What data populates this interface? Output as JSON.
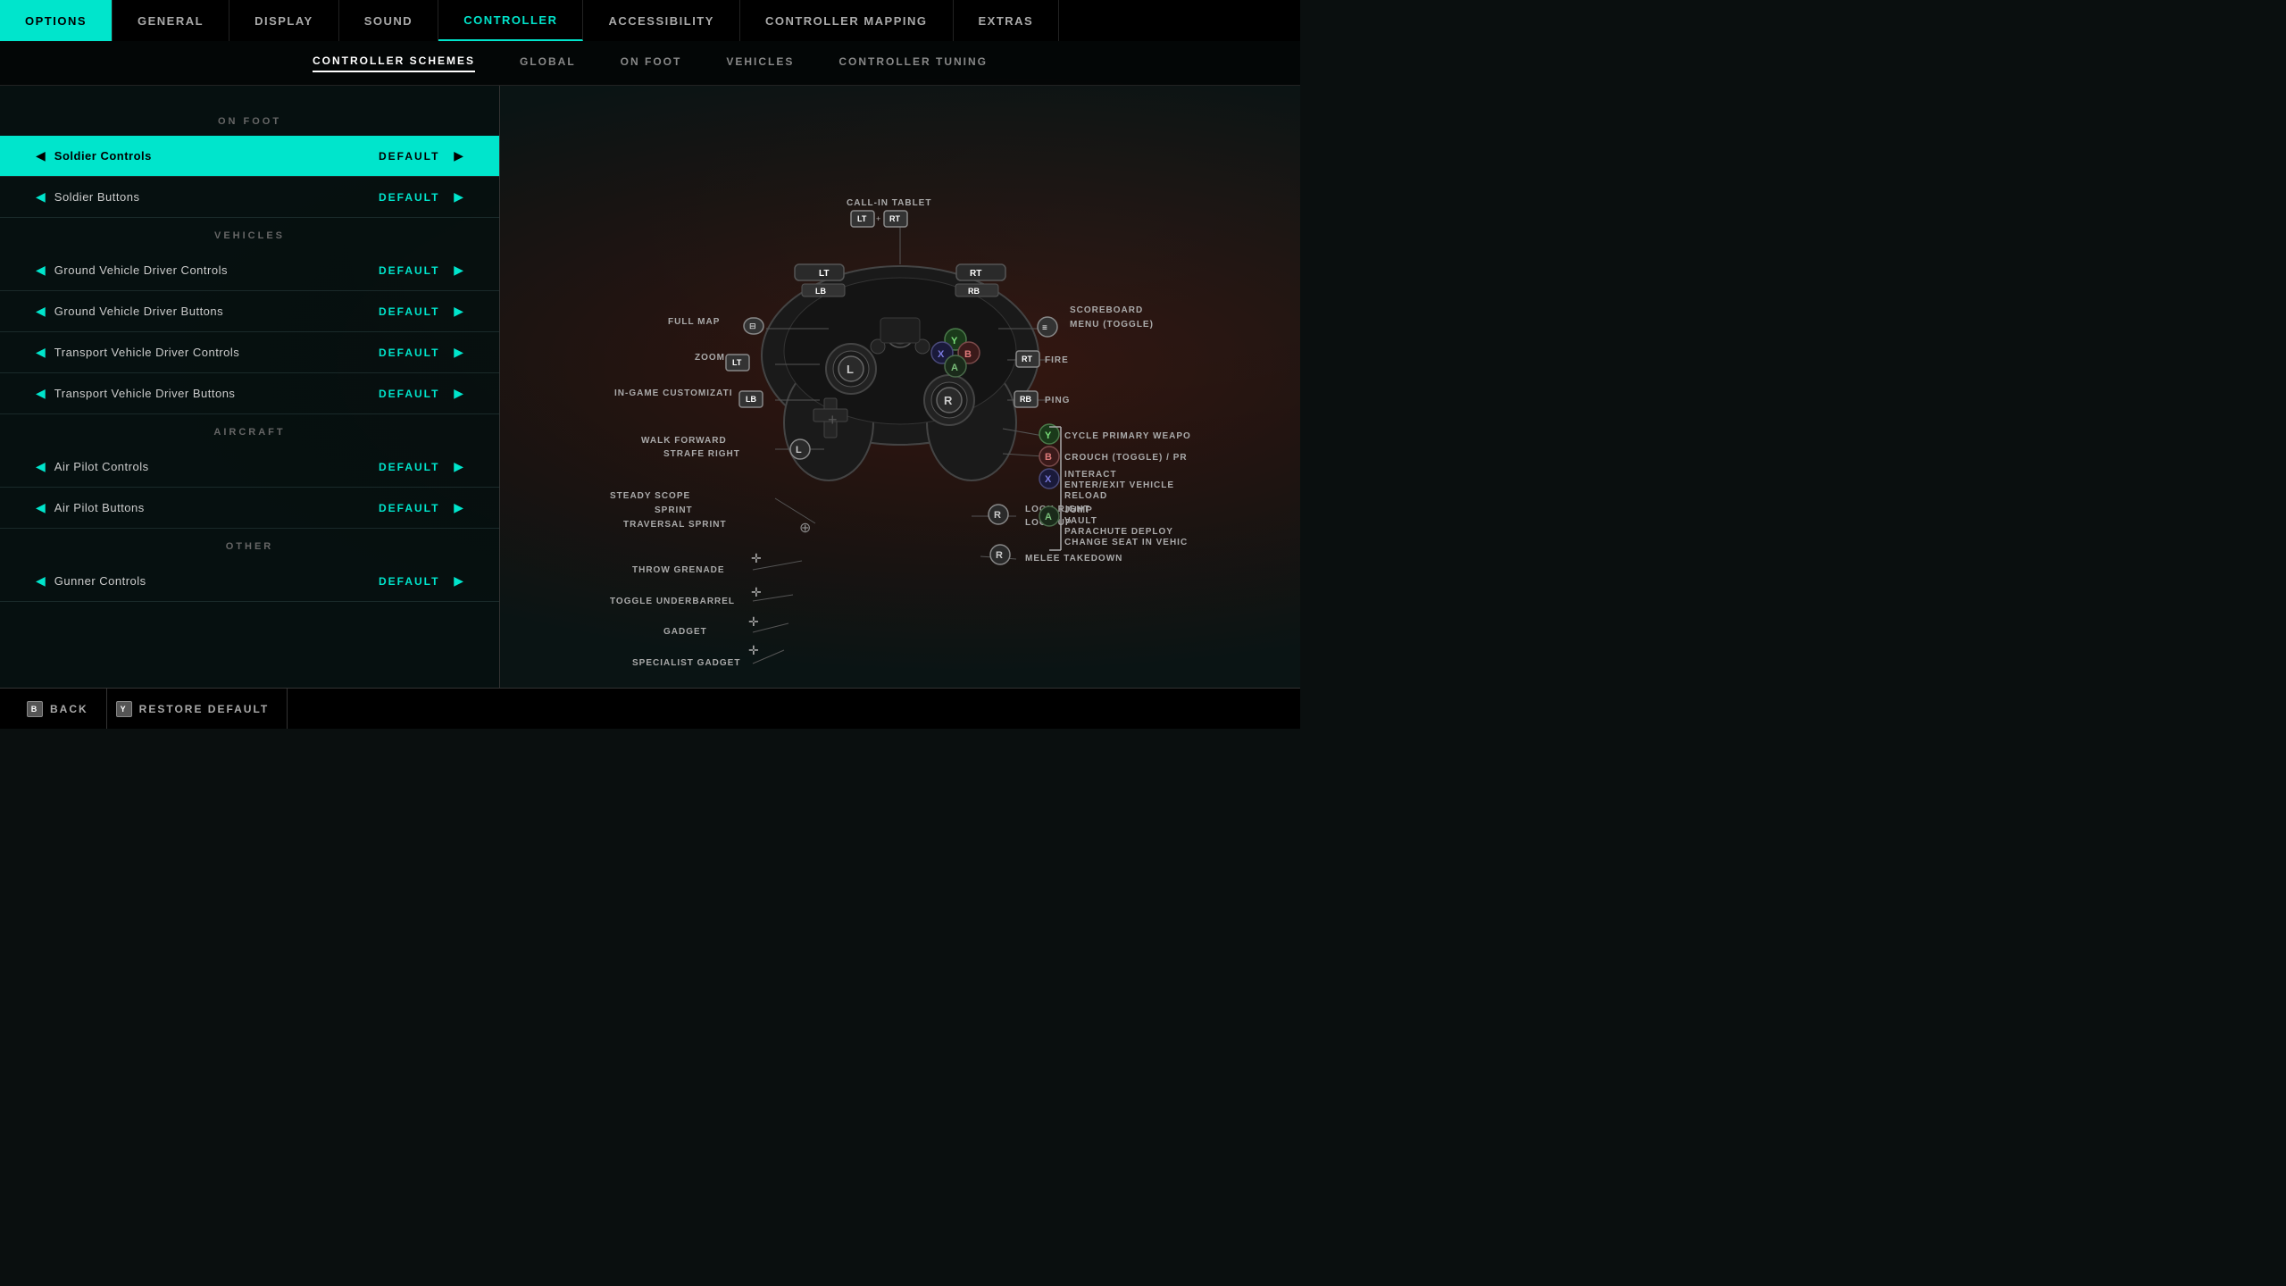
{
  "topNav": {
    "items": [
      {
        "id": "options",
        "label": "OPTIONS",
        "active": true
      },
      {
        "id": "general",
        "label": "GENERAL",
        "active": false
      },
      {
        "id": "display",
        "label": "DISPLAY",
        "active": false
      },
      {
        "id": "sound",
        "label": "SOUND",
        "active": false
      },
      {
        "id": "controller",
        "label": "CONTROLLER",
        "active": true,
        "highlighted": true
      },
      {
        "id": "accessibility",
        "label": "ACCESSIBILITY",
        "active": false
      },
      {
        "id": "controller-mapping",
        "label": "CONTROLLER MAPPING",
        "active": false
      },
      {
        "id": "extras",
        "label": "EXTRAS",
        "active": false
      }
    ]
  },
  "subNav": {
    "items": [
      {
        "id": "controller-schemes",
        "label": "CONTROLLER SCHEMES",
        "active": true
      },
      {
        "id": "global",
        "label": "GLOBAL",
        "active": false
      },
      {
        "id": "on-foot",
        "label": "ON FOOT",
        "active": false
      },
      {
        "id": "vehicles",
        "label": "VEHICLES",
        "active": false
      },
      {
        "id": "controller-tuning",
        "label": "CONTROLLER TUNING",
        "active": false
      }
    ]
  },
  "leftPanel": {
    "sections": [
      {
        "header": "ON FOOT",
        "items": [
          {
            "name": "Soldier Controls",
            "value": "DEFAULT",
            "highlighted": true
          },
          {
            "name": "Soldier Buttons",
            "value": "DEFAULT",
            "highlighted": false
          }
        ]
      },
      {
        "header": "VEHICLES",
        "items": [
          {
            "name": "Ground Vehicle Driver Controls",
            "value": "DEFAULT",
            "highlighted": false
          },
          {
            "name": "Ground Vehicle Driver Buttons",
            "value": "DEFAULT",
            "highlighted": false
          },
          {
            "name": "Transport Vehicle Driver Controls",
            "value": "DEFAULT",
            "highlighted": false
          },
          {
            "name": "Transport Vehicle Driver Buttons",
            "value": "DEFAULT",
            "highlighted": false
          }
        ]
      },
      {
        "header": "AIRCRAFT",
        "items": [
          {
            "name": "Air Pilot Controls",
            "value": "DEFAULT",
            "highlighted": false
          },
          {
            "name": "Air Pilot Buttons",
            "value": "DEFAULT",
            "highlighted": false
          }
        ]
      },
      {
        "header": "OTHER",
        "items": [
          {
            "name": "Gunner Controls",
            "value": "DEFAULT",
            "highlighted": false
          }
        ]
      }
    ]
  },
  "controllerDiagram": {
    "callInTablet": "CALL-IN TABLET",
    "callInKeys": "LT + RT",
    "fullMap": "FULL MAP",
    "zoom": "ZOOM",
    "zoomKey": "LT",
    "inGameCustomization": "IN-GAME CUSTOMIZATI",
    "inGameKey": "LB",
    "scoreboard": "SCOREBOARD",
    "scoreboardSub": "MENU (TOGGLE)",
    "fire": "FIRE",
    "fireKey": "RT",
    "ping": "PING",
    "pingKey": "RB",
    "walkForward": "WALK FORWARD",
    "strafeRight": "STRAFE RIGHT",
    "walkKey": "L",
    "steadyScope": "STEADY SCOPE",
    "sprint": "SPRINT",
    "traversalSprint": "TRAVERSAL SPRINT",
    "throwGrenade": "THROW GRENADE",
    "toggleUnderbarrel": "TOGGLE UNDERBARREL",
    "gadget": "GADGET",
    "specialistGadget": "SPECIALIST GADGET",
    "lookRight": "LOOK RIGHT",
    "lookUp": "LOOK UP",
    "lookKey": "R",
    "meleeTakedown": "MELEE TAKEDOWN",
    "meleeTakedownKey": "R",
    "cyclePrimaryWeapon": "CYCLE PRIMARY WEAPO",
    "cycleKey": "Y",
    "crouchToggle": "CROUCH (TOGGLE) / PR",
    "crouchKey": "B",
    "interact": "INTERACT",
    "enterExitVehicle": "ENTER/EXIT VEHICLE",
    "reload": "RELOAD",
    "interactKey": "X",
    "jump": "JUMP",
    "vault": "VAULT",
    "parachuteDeploy": "PARACHUTE DEPLOY",
    "changeSeat": "CHANGE SEAT IN VEHIC",
    "jumpKey": "A"
  },
  "bottomBar": {
    "backLabel": "BACK",
    "restoreDefaultLabel": "RESTORE DEFAULT"
  }
}
